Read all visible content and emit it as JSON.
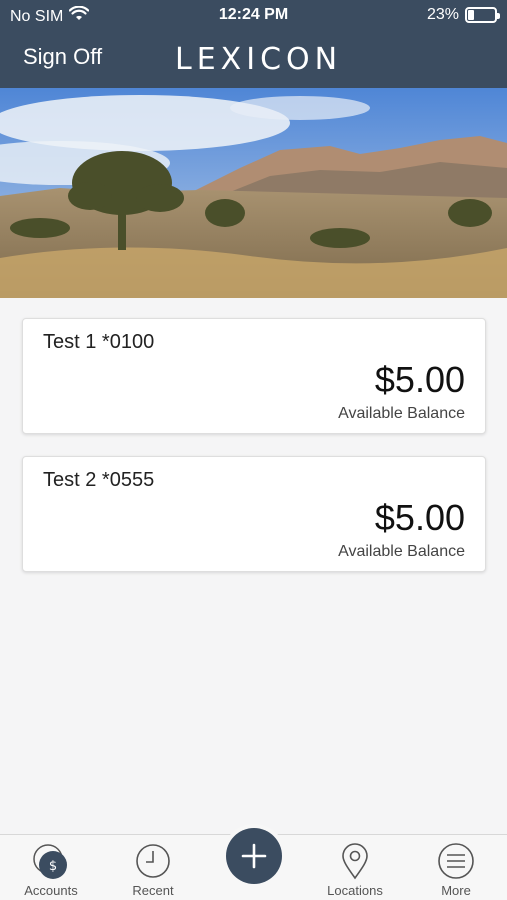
{
  "status": {
    "carrier": "No SIM",
    "time": "12:24 PM",
    "battery_percent_text": "23%",
    "battery_level": 0.23
  },
  "nav": {
    "sign_off_label": "Sign Off",
    "logo_text": "LEXICON"
  },
  "accounts": [
    {
      "name": "Test 1 *0100",
      "balance": "$5.00",
      "balance_label": "Available Balance"
    },
    {
      "name": "Test 2 *0555",
      "balance": "$5.00",
      "balance_label": "Available Balance"
    }
  ],
  "tabs": [
    {
      "label": "Accounts",
      "icon": "accounts-icon"
    },
    {
      "label": "Recent",
      "icon": "clock-icon"
    },
    {
      "label": "",
      "icon": "plus-icon"
    },
    {
      "label": "Locations",
      "icon": "location-pin-icon"
    },
    {
      "label": "More",
      "icon": "menu-icon"
    }
  ],
  "colors": {
    "header": "#3b4c60",
    "background": "#f5f5f6"
  }
}
